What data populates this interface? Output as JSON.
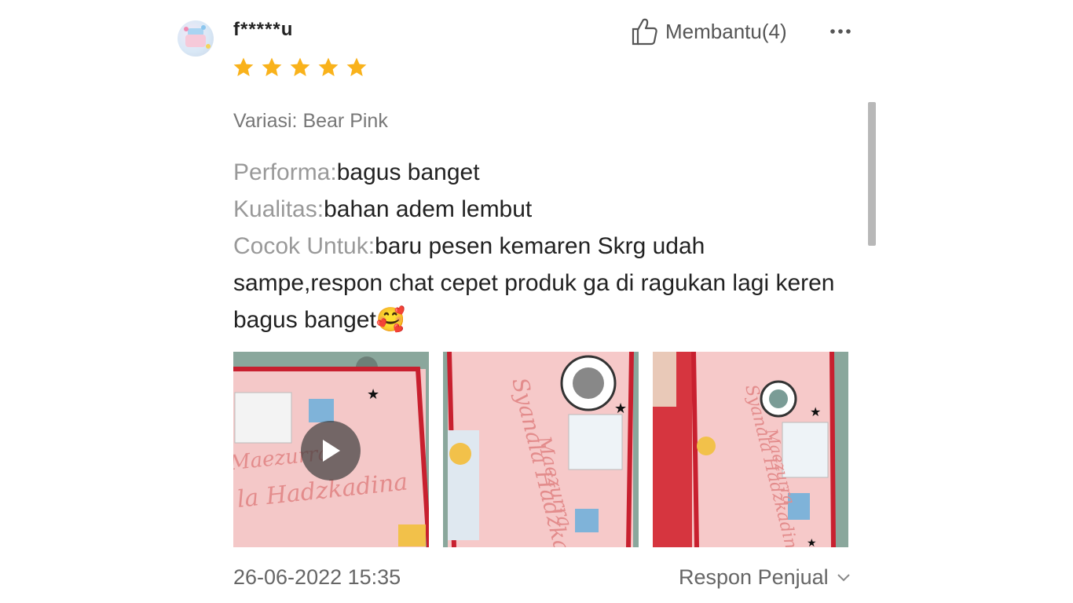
{
  "review": {
    "username": "f*****u",
    "rating": 5,
    "helpful_label": "Membantu(4)",
    "variation": "Variasi: Bear Pink",
    "lines": [
      {
        "key": "Performa:",
        "value": "bagus banget"
      },
      {
        "key": "Kualitas:",
        "value": "bahan adem lembut"
      },
      {
        "key": "Cocok Untuk:",
        "value": "baru pesen kemaren Skrg udah sampe,respon chat cepet produk ga di ragukan lagi keren bagus banget🥰"
      }
    ],
    "media": [
      {
        "type": "video",
        "text1": "Maezurra",
        "text2": "la Hadzkadina"
      },
      {
        "type": "photo",
        "text1": "Maezurra",
        "text2": "Syanala Hadzka"
      },
      {
        "type": "photo",
        "text1": "Maezurra",
        "text2": "Syanala Hadzkadina"
      }
    ],
    "timestamp": "26-06-2022 15:35",
    "seller_reply_label": "Respon Penjual"
  },
  "colors": {
    "star": "#f9b21b",
    "accent_pink": "#f2c3c6",
    "frame_red": "#c8202f"
  },
  "icons": [
    "thumbs-up-icon",
    "more-icon",
    "star-icon",
    "play-icon",
    "chevron-down-icon"
  ]
}
